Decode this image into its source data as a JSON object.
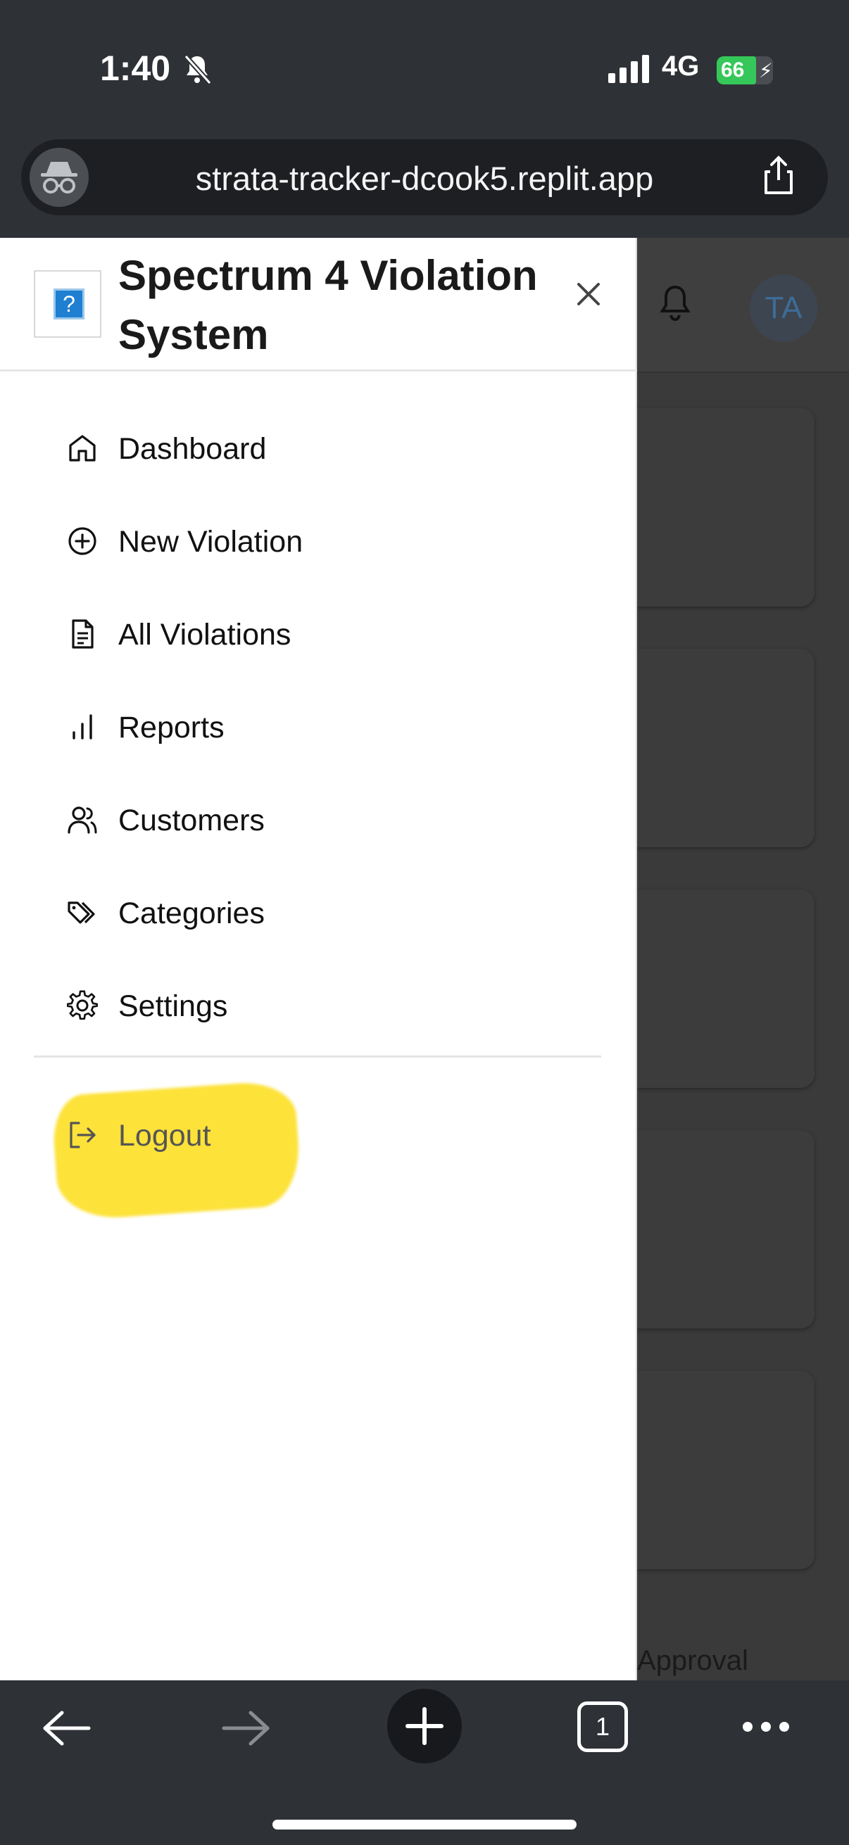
{
  "status_bar": {
    "time": "1:40",
    "network": "4G",
    "battery": "66"
  },
  "browser": {
    "url": "strata-tracker-dcook5.replit.app",
    "tab_count": "1"
  },
  "drawer": {
    "title": "Spectrum 4 Violation System",
    "nav": [
      {
        "label": "Dashboard",
        "icon": "home-icon"
      },
      {
        "label": "New Violation",
        "icon": "plus-circle-icon"
      },
      {
        "label": "All Violations",
        "icon": "document-icon"
      },
      {
        "label": "Reports",
        "icon": "bar-chart-icon"
      },
      {
        "label": "Customers",
        "icon": "users-icon"
      },
      {
        "label": "Categories",
        "icon": "tags-icon"
      },
      {
        "label": "Settings",
        "icon": "gear-icon"
      }
    ],
    "logout": "Logout"
  },
  "background_app": {
    "avatar_initials": "TA",
    "visible_text": "Approval"
  },
  "colors": {
    "highlight": "#fde23a",
    "accent": "#1f7fd1"
  }
}
